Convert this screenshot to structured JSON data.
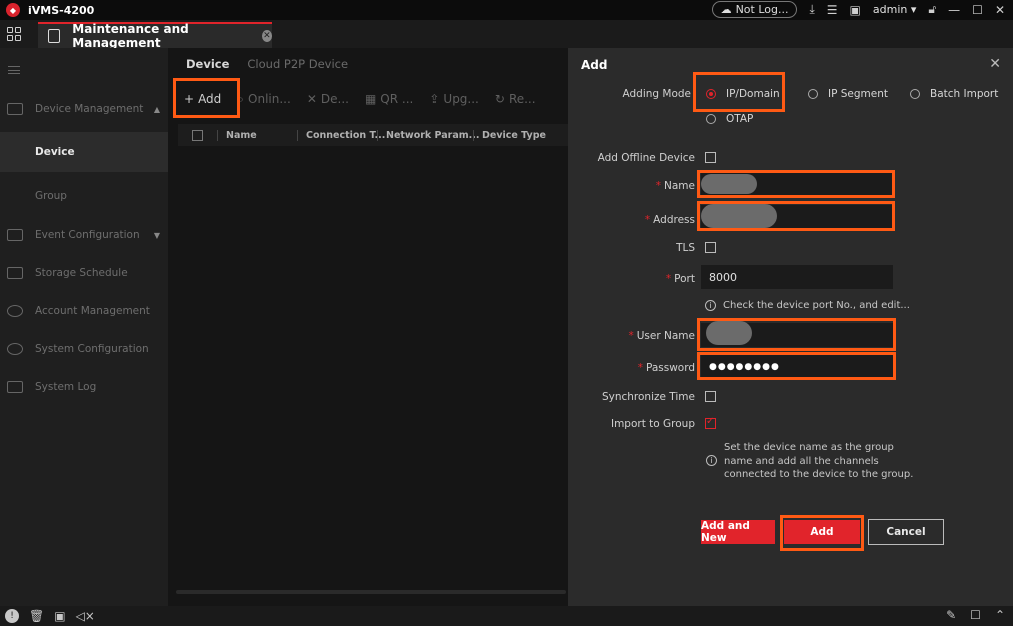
{
  "titlebar": {
    "app_name": "iVMS-4200",
    "cloud_label": "Not Log...",
    "user": "admin"
  },
  "tab": {
    "title": "Maintenance and Management"
  },
  "sidebar": {
    "items": [
      {
        "label": "Device Management"
      },
      {
        "label": "Device"
      },
      {
        "label": "Group"
      },
      {
        "label": "Event Configuration"
      },
      {
        "label": "Storage Schedule"
      },
      {
        "label": "Account Management"
      },
      {
        "label": "System Configuration"
      },
      {
        "label": "System Log"
      }
    ]
  },
  "main": {
    "subtabs": [
      "Device",
      "Cloud P2P Device"
    ],
    "toolbar": {
      "add": "Add",
      "online": "Onlin...",
      "delete": "De...",
      "qr": "QR ...",
      "upgrade": "Upg...",
      "refresh": "Re..."
    },
    "columns": [
      "Name",
      "Connection T...",
      "Network Param...",
      "Device Type"
    ]
  },
  "dialog": {
    "title": "Add",
    "adding_mode_label": "Adding Mode",
    "modes": [
      "IP/Domain",
      "IP Segment",
      "Batch Import",
      "OTAP"
    ],
    "selected_mode": "IP/Domain",
    "add_offline_label": "Add Offline Device",
    "name_label": "Name",
    "address_label": "Address",
    "tls_label": "TLS",
    "port_label": "Port",
    "port_value": "8000",
    "port_hint": "Check the device port No., and edit...",
    "username_label": "User Name",
    "password_label": "Password",
    "password_value": "●●●●●●●●",
    "sync_time_label": "Synchronize Time",
    "import_group_label": "Import to Group",
    "group_hint_1": "Set the device name as the group",
    "group_hint_2": "name and add all the channels",
    "group_hint_3": "connected to the device to the group.",
    "btn_add_new": "Add and New",
    "btn_add": "Add",
    "btn_cancel": "Cancel",
    "required_mark": "*"
  },
  "colors": {
    "accent": "#e1242b",
    "highlight": "#ff5a14"
  }
}
